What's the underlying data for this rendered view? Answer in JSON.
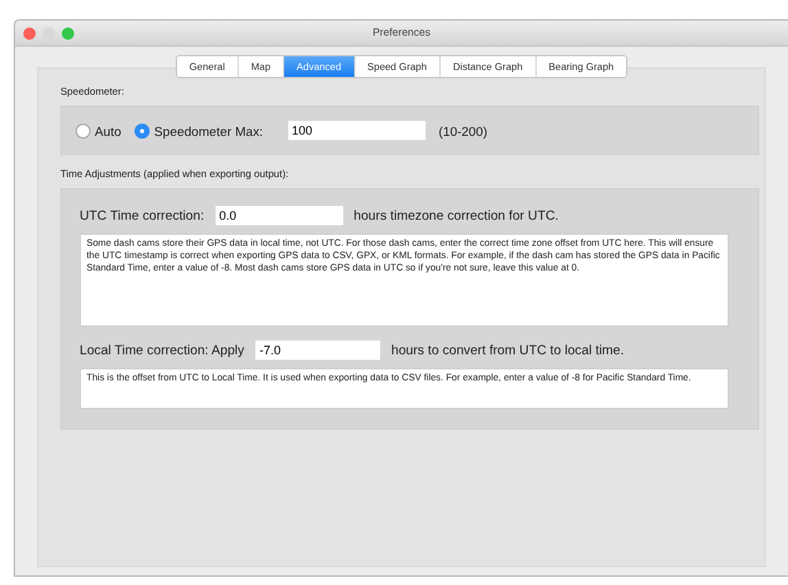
{
  "window": {
    "title": "Preferences"
  },
  "tabs": [
    {
      "label": "General",
      "selected": false
    },
    {
      "label": "Map",
      "selected": false
    },
    {
      "label": "Advanced",
      "selected": true
    },
    {
      "label": "Speed Graph",
      "selected": false
    },
    {
      "label": "Distance Graph",
      "selected": false
    },
    {
      "label": "Bearing Graph",
      "selected": false
    }
  ],
  "speedometer": {
    "label": "Speedometer:",
    "options": [
      {
        "label": "Auto",
        "selected": false
      },
      {
        "label": "Speedometer Max:",
        "selected": true
      }
    ],
    "max_value": "100",
    "range_hint": "(10-200)"
  },
  "time_adjustments": {
    "label": "Time Adjustments (applied when exporting output):",
    "utc": {
      "label": "UTC Time correction:",
      "value": "0.0",
      "suffix": "hours timezone correction for UTC.",
      "description": "Some dash cams store their GPS data in local time, not UTC. For those dash cams, enter the correct time zone offset from UTC here. This will ensure the UTC timestamp is correct when exporting GPS data to CSV, GPX, or KML formats. For example, if the dash cam has stored the GPS data in Pacific Standard Time, enter a value of -8. Most dash cams store GPS data in UTC so if you're not sure, leave this value at 0."
    },
    "local": {
      "label": "Local Time correction: Apply",
      "value": "-7.0",
      "suffix": "hours to convert from UTC to local time.",
      "description": "This is the offset from UTC to Local Time. It is used when exporting data to CSV files. For example, enter a value of -8 for Pacific Standard Time."
    }
  }
}
